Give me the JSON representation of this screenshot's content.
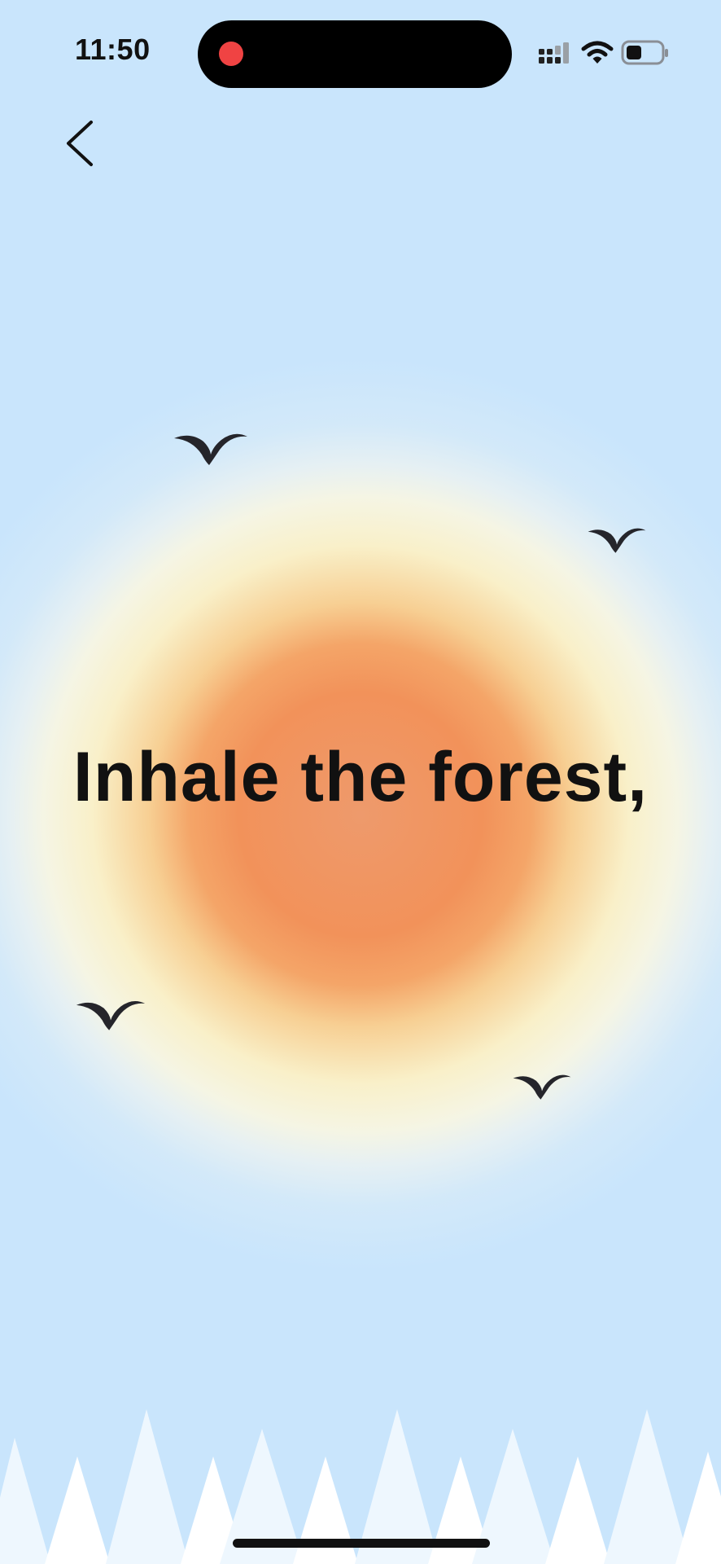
{
  "status_bar": {
    "time": "11:50"
  },
  "main": {
    "breath_text": "Inhale the forest,"
  },
  "icons": {
    "back": "chevron-left-icon",
    "signal": "cellular-signal-icon",
    "wifi": "wifi-icon",
    "battery": "battery-icon",
    "bird": "bird-icon"
  },
  "colors": {
    "sky": "#c9e5fc",
    "sun_core": "#f2925a",
    "sun_glow": "#f9f0c9",
    "text": "#111111",
    "record_dot": "#f04343"
  }
}
